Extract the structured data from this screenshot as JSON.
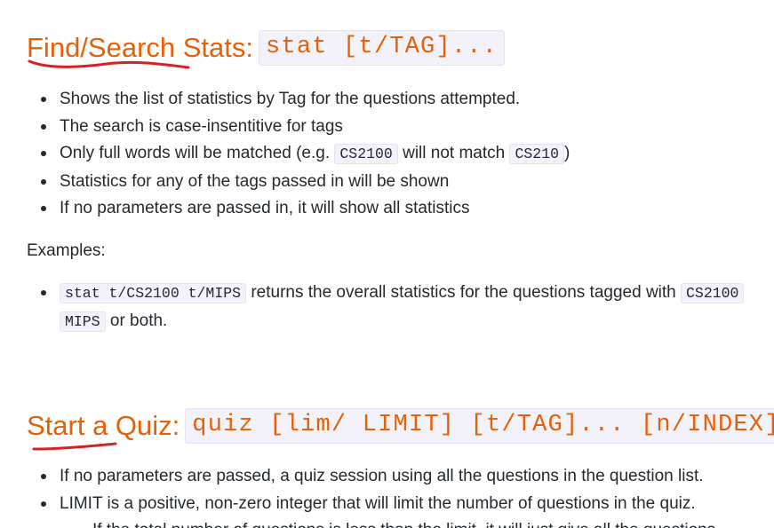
{
  "section1": {
    "title": "Find/Search Stats:",
    "command": "stat [t/TAG]...",
    "bullets": {
      "b1": "Shows the list of statistics by Tag for the questions attempted.",
      "b2": "The search is case-insentitive for tags",
      "b3_pre": "Only full words will be matched (e.g. ",
      "b3_code1": "CS2100",
      "b3_mid": " will not match ",
      "b3_code2": "CS210",
      "b3_post": ")",
      "b4": "Statistics for any of the tags passed in will be shown",
      "b5": "If no parameters are passed in, it will show all statistics"
    },
    "examples_label": "Examples:",
    "example": {
      "code1": "stat t/CS2100 t/MIPS",
      "text1": " returns the overall statistics for the questions tagged with ",
      "code2": "CS2100",
      "code3": "MIPS",
      "text2": " or both."
    }
  },
  "section2": {
    "title": "Start a Quiz:",
    "command": "quiz [lim/ LIMIT] [t/TAG]... [n/INDEX]",
    "bullets": {
      "b1": "If no parameters are passed, a quiz session using all the questions in the question list.",
      "b2": "LIMIT is a positive, non-zero integer that will limit the number of questions in the quiz.",
      "b3": "If the total number of questions is less than the limit, it will just give all the questions"
    }
  },
  "colors": {
    "heading": "#e36209",
    "annotation_ink": "#d92020",
    "code_bg": "#f3f2fa"
  }
}
